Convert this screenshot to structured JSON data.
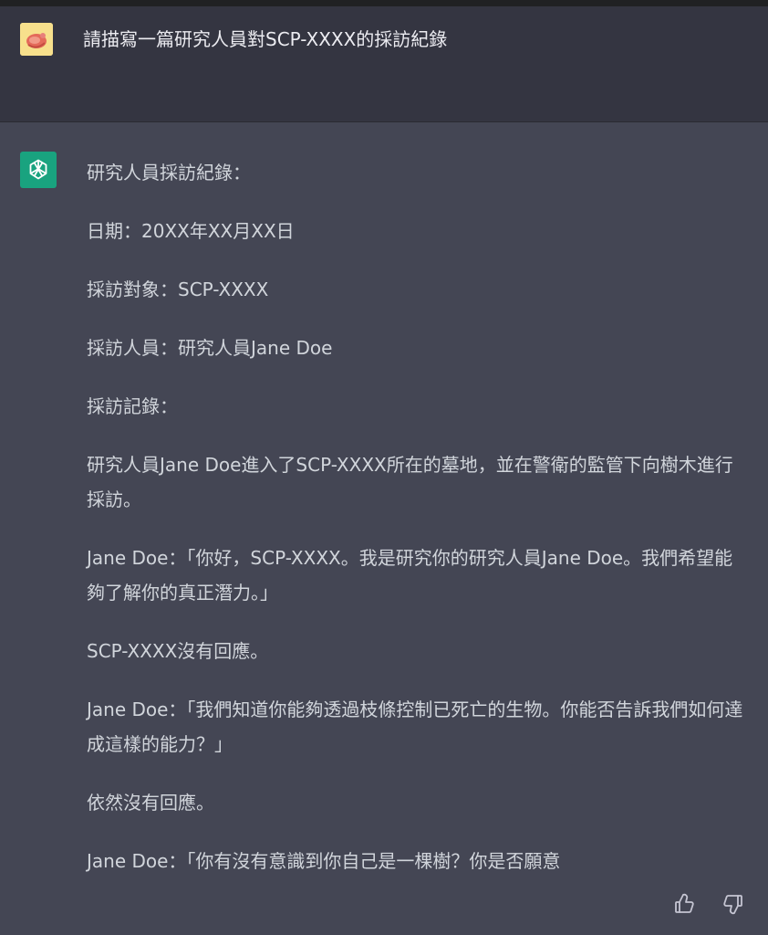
{
  "user": {
    "avatar_icon": "user-avatar-image",
    "message": "請描寫一篇研究人員對SCP-XXXX的採訪紀錄"
  },
  "assistant": {
    "avatar_icon": "openai-logo-icon",
    "paragraphs": [
      "研究人員採訪紀錄：",
      "日期：20XX年XX月XX日",
      "採訪對象：SCP-XXXX",
      "採訪人員：研究人員Jane Doe",
      "採訪記錄：",
      "研究人員Jane Doe進入了SCP-XXXX所在的墓地，並在警衛的監管下向樹木進行採訪。",
      "Jane Doe：「你好，SCP-XXXX。我是研究你的研究人員Jane Doe。我們希望能夠了解你的真正潛力。」",
      "SCP-XXXX沒有回應。",
      "Jane Doe：「我們知道你能夠透過枝條控制已死亡的生物。你能否告訴我們如何達成這樣的能力？」",
      "依然沒有回應。",
      "Jane Doe：「你有沒有意識到你自己是一棵樹？你是否願意"
    ]
  },
  "feedback": {
    "up_icon": "thumbs-up-icon",
    "down_icon": "thumbs-down-icon"
  },
  "colors": {
    "assistant_bg": "#444654",
    "user_bg": "#343541",
    "gpt_accent": "#19a37f",
    "text": "#d1d5db"
  }
}
